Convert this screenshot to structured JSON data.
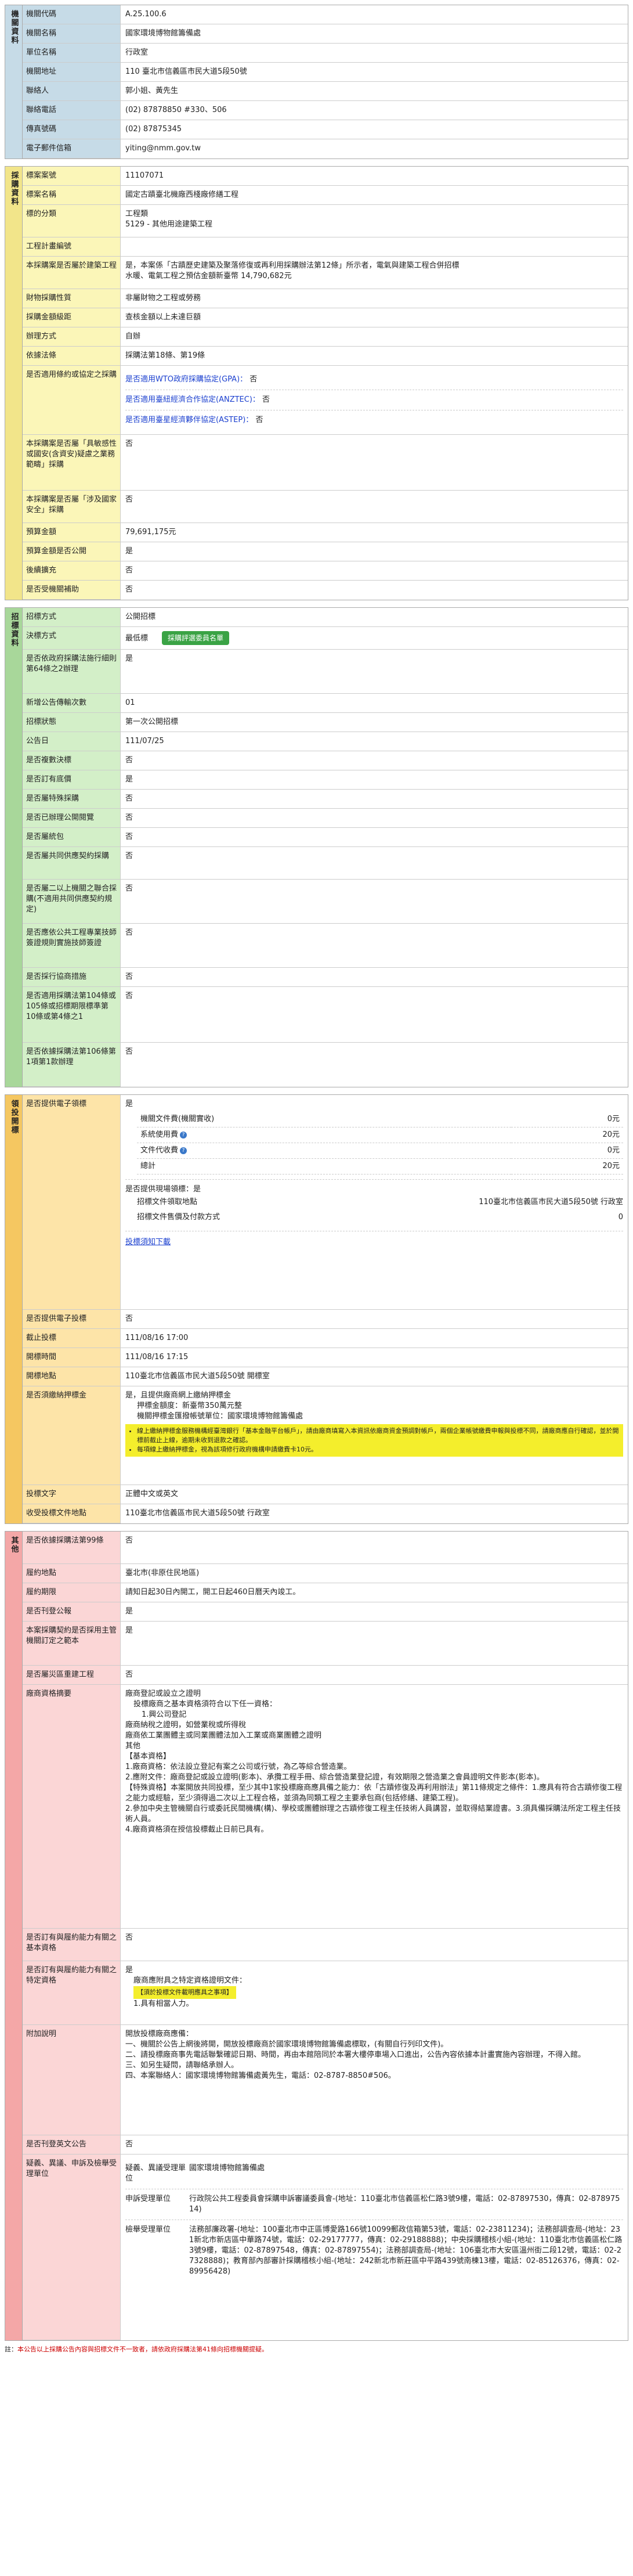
{
  "agency": {
    "side": "機關資料",
    "rows": [
      {
        "k": "機關代碼",
        "v": "A.25.100.6"
      },
      {
        "k": "機關名稱",
        "v": "國家環境博物館籌備處"
      },
      {
        "k": "單位名稱",
        "v": "行政室"
      },
      {
        "k": "機關地址",
        "v": "110 臺北市信義區市民大道5段50號"
      },
      {
        "k": "聯絡人",
        "v": "郭小姐、黃先生"
      },
      {
        "k": "聯絡電話",
        "v": "(02) 87878850 #330、506"
      },
      {
        "k": "傳真號碼",
        "v": "(02) 87875345"
      },
      {
        "k": "電子郵件信箱",
        "v": "yiting@nmm.gov.tw"
      }
    ]
  },
  "tender": {
    "side": "採購資料",
    "case_no": "11107071",
    "case_name": "國定古蹟臺北機廠西棧廠修繕工程",
    "category_l1": "工程類",
    "category_l2": "5129 - 其他用途建築工程",
    "cost_label": "工程計畫編號",
    "enterprise_label": "本採購案是否屬於建築工程",
    "enterprise_v1": "是，本案係「古蹟歷史建築及聚落修復或再利用採購辦法第12條」所示者，電氣與建築工程合併招標",
    "enterprise_v2": "水暖、電氣工程之預估金額新臺幣 14,790,682元",
    "subject_label": "財物採購性質",
    "subject_v": "非屬財物之工程或勞務",
    "budget_label": "採購金額級距",
    "budget_v": "查核金額以上未達巨額",
    "method_label": "辦理方式",
    "method_v": "自辦",
    "law_label": "依據法條",
    "law_v": "採購法第18條、第19條",
    "gpa_label": "是否適用條約或協定之採購",
    "gpa_items": [
      {
        "text": "是否適用WTO政府採購協定(GPA)：",
        "ans": "否"
      },
      {
        "text": "是否適用臺紐經濟合作協定(ANZTEC)：",
        "ans": "否"
      },
      {
        "text": "是否適用臺星經濟夥伴協定(ASTEP)：",
        "ans": "否"
      }
    ],
    "special_label": "本採購案是否屬「具敏感性或國安(含資安)疑慮之業務範疇」採購",
    "special_v": "否",
    "defense_label": "本採購案是否屬「涉及國家安全」採購",
    "defense_v": "否",
    "amount_label": "預算金額",
    "amount_v": "79,691,175元",
    "public_label": "預算金額是否公開",
    "public_v": "是",
    "future_label": "後續擴充",
    "future_v": "否",
    "subsidy_label": "是否受機關補助",
    "subsidy_v": "否"
  },
  "bid": {
    "side": "招標資料",
    "rows": [
      {
        "k": "招標方式",
        "v": "公開招標"
      },
      {
        "k": "決標方式",
        "v": "最低標",
        "btn": "採購評選委員名單"
      },
      {
        "k": "是否依政府採購法施行細則第64條之2辦理",
        "v": "是",
        "h": "h-md"
      },
      {
        "k": "新增公告傳輸次數",
        "v": "01"
      },
      {
        "k": "招標狀態",
        "v": "第一次公開招標"
      },
      {
        "k": "公告日",
        "v": "111/07/25"
      },
      {
        "k": "是否複數決標",
        "v": "否"
      },
      {
        "k": "是否訂有底價",
        "v": "是"
      },
      {
        "k": "是否屬特殊採購",
        "v": "否"
      },
      {
        "k": "是否已辦理公開閱覽",
        "v": "否"
      },
      {
        "k": "是否屬統包",
        "v": "否"
      },
      {
        "k": "是否屬共同供應契約採購",
        "v": "否",
        "h": "h-sm"
      },
      {
        "k": "是否屬二以上機關之聯合採購(不適用共同供應契約規定)",
        "v": "否",
        "h": "h-md"
      },
      {
        "k": "是否應依公共工程專業技師簽證規則實施技師簽證",
        "v": "否",
        "h": "h-md"
      },
      {
        "k": "是否採行協商措施",
        "v": "否"
      },
      {
        "k": "是否適用採購法第104條或105條或招標期限標準第10條或第4條之1",
        "v": "否",
        "h": "h-lg"
      },
      {
        "k": "是否依據採購法第106條第1項第1款辦理",
        "v": "否",
        "h": "h-md"
      }
    ]
  },
  "collect": {
    "side": "領投開標",
    "elec_label": "是否提供電子領標",
    "elec_v": "是",
    "fees": [
      {
        "k": "機關文件費(機關實收)",
        "v": "0元"
      },
      {
        "k": "系統使用費",
        "v": "20元",
        "q": true
      },
      {
        "k": "文件代收費",
        "v": "0元",
        "q": true
      },
      {
        "k": "總計",
        "v": "20元"
      }
    ],
    "paper_label": "是否提供現場領標：是",
    "paper_addr_k": "招標文件領取地點",
    "paper_addr_v": "110臺北市信義區市民大道5段50號 行政室",
    "paper_fee_k": "招標文件售價及付款方式",
    "paper_fee_v": "0",
    "download": "投標須知下載",
    "e_bid_label": "是否提供電子投標",
    "e_bid_v": "否",
    "deadline_label": "截止投標",
    "deadline_v": "111/08/16 17:00",
    "open_label": "開標時間",
    "open_v": "111/08/16 17:15",
    "place_label": "開標地點",
    "place_v": "110臺北市信義區市民大道5段50號 開標室",
    "deposit_label": "是否須繳納押標金",
    "deposit_lines": [
      "是，且提供廠商網上繳納押標金",
      "押標金額度：新臺幣350萬元整",
      "機關押標金匯撥帳號單位：國家環境博物館籌備處"
    ],
    "deposit_notes": [
      "線上繳納押標金服務機構經臺灣銀行「基本金融平台帳戶」，請由廠商填寫入本資訊依廠商資金預調對帳戶，兩個企業帳號繳費申報與投標不同，請廠商應自行確認，並於開標前截止上線，逾期未收到退款之確認。",
      "每項線上繳納押標金，視為該項修行政府機構申請繳費卡10元。"
    ],
    "lang_label": "投標文字",
    "lang_v": "正體中文或英文",
    "receive_label": "收受投標文件地點",
    "receive_v": "110臺北市信義區市民大道5段50號 行政室"
  },
  "other": {
    "side": "其他",
    "r1k": "是否依據採購法第99條",
    "r1v": "否",
    "r2k": "履約地點",
    "r2v": "臺北市(非原住民地區)",
    "r3k": "履約期限",
    "r3v": "請知日起30日內開工，開工日起460日曆天內竣工。",
    "r4k": "是否刊登公報",
    "r4v": "是",
    "r5k": "本案採購契約是否採用主管機關訂定之範本",
    "r5v": "是",
    "r6k": "是否屬災區重建工程",
    "r6v": "否",
    "r7k": "廠商資格摘要",
    "r7lines": [
      "廠商登記或設立之證明",
      "投標廠商之基本資格須符合以下任一資格：",
      "1.興公司登記",
      "廠商納稅之證明，如營業稅或所得稅",
      "廠商依工業團體主或同業團體法加入工業或商業團體之證明",
      "其他",
      "【基本資格】",
      "1.廠商資格：依法設立登記有案之公司或行號，為乙等綜合營造業。",
      "2.應附文件：廠商登記或設立證明(影本)、承攬工程手冊、綜合營造業登記證，有效期限之營造業之會員證明文件影本(影本)。",
      "【特殊資格】本案開放共同投標，至少其中1家投標廠商應具備之能力：依「古蹟修復及再利用辦法」第11條規定之條件：1.應具有符合古蹟修復工程之能力或經驗，至少須得過二次以上工程合格，並須為同類工程之主要承包商(包括修繕、建築工程)。",
      "2.參加中央主管機關自行或委託民間機構(構)、學校或團體辦理之古蹟修復工程主任技術人員講習，並取得結業證書。3.須具備採購法所定工程主任技術人員。",
      "4.廠商資格須在授信投標截止日前已具有。"
    ],
    "r8k": "是否訂有與履約能力有關之基本資格",
    "r8v": "否",
    "r9k": "是否訂有與履約能力有關之特定資格",
    "r9v": "是",
    "r9extra": "廠商應附具之特定資格證明文件：",
    "r9hl": "【須於投標文件載明應具之事項】",
    "r9last": "1.具有相當人力。",
    "r10k": "附加說明",
    "r10lines": [
      "開放投標廠商應備：",
      "一、機關於公告上網後將開，開放投標廠商於國家環境博物館籌備處標取，(有關自行列印文件)。",
      "二、請投標廠商事先電話聯繫確認日期、時間，再由本館陪同於本署大樓停車場入口進出，公告內容依據本計畫實施內容辦理，不得入館。",
      "三、如另生疑問，請聯絡承辦人。",
      "四、本案聯絡人：國家環境博物館籌備處黃先生，電話：02-8787-8850#506。"
    ],
    "r11k": "是否刊登英文公告",
    "r11v": "否",
    "r12k": "疑義、異議、申訴及檢舉受理單位",
    "agencies": [
      {
        "k": "疑義、異議受理單位",
        "v": "國家環境博物館籌備處"
      },
      {
        "k": "申訴受理單位",
        "v": "行政院公共工程委員會採購申訴審議委員會-(地址：110臺北市信義區松仁路3號9樓，電話：02-87897530，傳真：02-87897514)"
      },
      {
        "k": "檢舉受理單位",
        "v": "法務部廉政署-(地址：100臺北市中正區博愛路166號10099郵政信箱第53號，電話：02-23811234)；法務部調查局-(地址：231新北市新店區中華路74號，電話：02-29177777，傳真：02-29188888)；中央採購稽核小組-(地址：110臺北市信義區松仁路3號9樓，電話：02-87897548，傳真：02-87897554)；法務部調查局-(地址：106臺北市大安區溫州街二段12號，電話：02-27328888)；教育部內部審計採購稽核小組-(地址：242新北市新莊區中平路439號南棟13樓，電話：02-85126376，傳真：02-89956428)"
      }
    ]
  },
  "foot_pre": "註：",
  "foot_red": "本公告以上採購公告內容與招標文件不一致者，請依政府採購法第41條向招標機關提疑。"
}
